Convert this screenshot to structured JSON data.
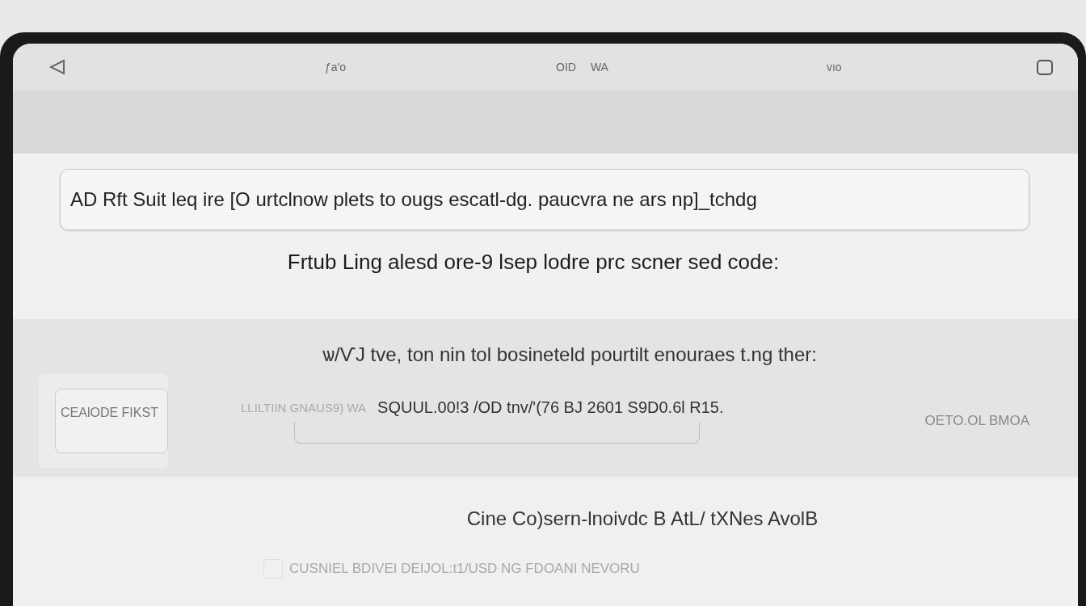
{
  "status_bar": {
    "left_text": "ƒa'o",
    "center_texts": [
      "OID",
      "WA"
    ],
    "right_text": "vıo"
  },
  "search_field": {
    "value": "AD  Rft Suit leq ire [O urtclnow plets to ougs escatl-dg. paucvra ne ars np]_tchdg"
  },
  "heading": "Frtub Ling alesd ore-9 lsep lodre prc scner sed code:",
  "panel": {
    "title": "ѡ/ѴJ tve, ton nin tol bosineteld pourtilt enouraes t.ng ther:",
    "left_button": "CEAlODE FIKST",
    "field_label": "LLILTIIN GNAUS9) WA",
    "field_value": "SQUUL.00!3 /OD tnv/'(76 BJ  2601 S9D0.6l R15.",
    "right_text": "OETO.OL BMOA"
  },
  "footer": {
    "text": "Cine Co)sern-lnoivdc B AtL/ tXNes AvolB",
    "checkbox": {
      "label": "CUSNIEL BDIVEI DEIJOL:t1/USD NG FDOANI NEVORU",
      "checked": false
    }
  }
}
